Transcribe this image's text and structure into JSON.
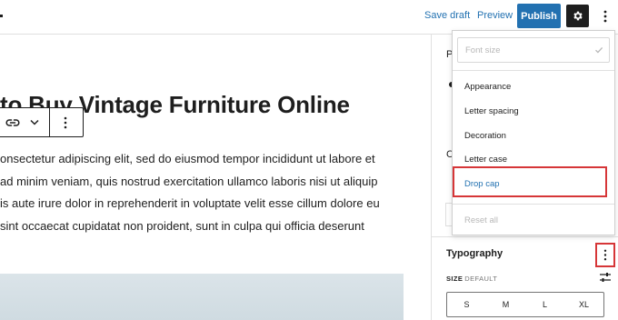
{
  "header": {
    "save_draft": "Save draft",
    "preview": "Preview",
    "publish": "Publish",
    "settings_icon": "gear-icon",
    "more_icon": "vertical-ellipsis-icon"
  },
  "editor": {
    "title": "to Buy Vintage Furniture Online",
    "paragraph_lines": [
      "onsectetur adipiscing elit, sed do eiusmod tempor incididunt ut labore et",
      "ad minim veniam, quis nostrud exercitation ullamco laboris nisi ut aliquip",
      "is aute irure dolor in reprehenderit in voluptate velit esse cillum dolore eu",
      "sint occaecat cupidatat non proident, sunt in culpa qui officia deserunt"
    ],
    "block_toolbar": {
      "link_icon": "link-icon",
      "chevron_icon": "chevron-down-icon",
      "more_icon": "vertical-ellipsis-icon"
    }
  },
  "typography_menu": {
    "font_size": "Font size",
    "items": [
      "Appearance",
      "Letter spacing",
      "Decoration",
      "Letter case"
    ],
    "drop_cap": "Drop cap",
    "reset_all": "Reset all"
  },
  "sidebar": {
    "fragment_top": "P",
    "fragment_mid": "C",
    "typography_title": "Typography",
    "size_label": "SIZE",
    "size_value": "DEFAULT",
    "size_options": [
      "S",
      "M",
      "L",
      "XL"
    ]
  },
  "colors": {
    "accent": "#2271b1",
    "highlight": "#d63638",
    "text": "#1e1e1e"
  }
}
